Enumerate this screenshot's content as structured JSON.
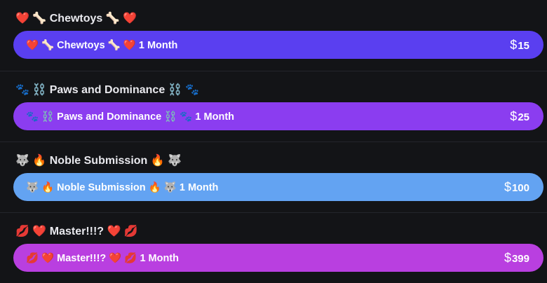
{
  "tiers": [
    {
      "title": "❤️ 🦴 Chewtoys 🦴 ❤️",
      "button_label": "❤️ 🦴 Chewtoys 🦴 ❤️ 1 Month",
      "currency": "$",
      "price": "15",
      "color": "#5a3ff0"
    },
    {
      "title": "🐾 ⛓️ Paws and Dominance ⛓️ 🐾",
      "button_label": "🐾 ⛓️ Paws and Dominance ⛓️ 🐾 1 Month",
      "currency": "$",
      "price": "25",
      "color": "#8b3df0"
    },
    {
      "title": "🐺 🔥 Noble Submission 🔥 🐺",
      "button_label": "🐺 🔥 Noble Submission 🔥 🐺 1 Month",
      "currency": "$",
      "price": "100",
      "color": "#63a3f2"
    },
    {
      "title": "💋 ❤️ Master!!!? ❤️ 💋",
      "button_label": "💋 ❤️ Master!!!? ❤️ 💋 1 Month",
      "currency": "$",
      "price": "399",
      "color": "#b93fe0"
    }
  ]
}
